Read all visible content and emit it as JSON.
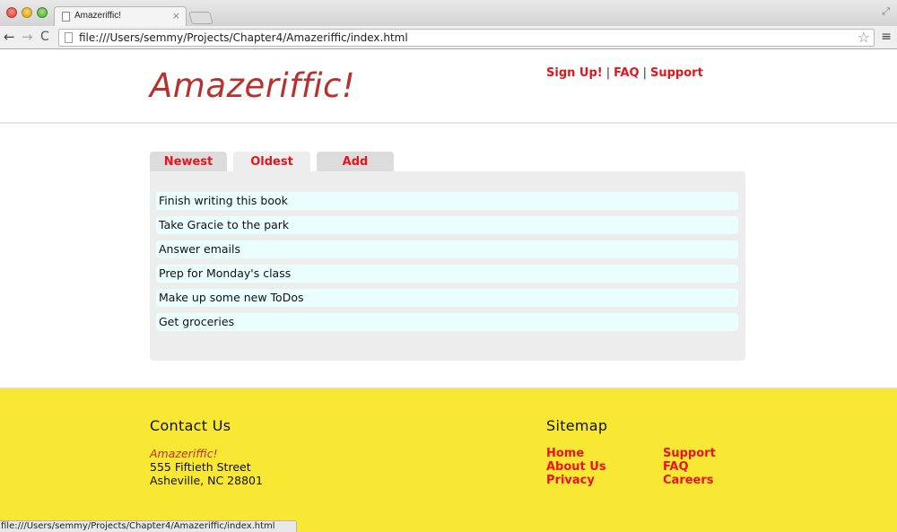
{
  "browser": {
    "tab_title": "Amazeriffic!",
    "tab_close": "×",
    "url": "file:///Users/semmy/Projects/Chapter4/Amazeriffic/index.html",
    "status_url": "file:///Users/semmy/Projects/Chapter4/Amazeriffic/index.html",
    "icons": {
      "back": "←",
      "forward": "→",
      "reload": "C",
      "star": "☆",
      "menu": "≡",
      "fullscreen": "⤢"
    }
  },
  "header": {
    "logo": "Amazeriffic!",
    "nav": [
      {
        "label": "Sign Up!"
      },
      {
        "label": "FAQ"
      },
      {
        "label": "Support"
      }
    ],
    "separator": "|"
  },
  "tabs": [
    {
      "label": "Newest",
      "active": false
    },
    {
      "label": "Oldest",
      "active": true
    },
    {
      "label": "Add",
      "active": false
    }
  ],
  "todos": [
    "Finish writing this book",
    "Take Gracie to the park",
    "Answer emails",
    "Prep for Monday's class",
    "Make up some new ToDos",
    "Get groceries"
  ],
  "footer": {
    "contact": {
      "heading": "Contact Us",
      "brand": "Amazeriffic!",
      "street": "555 Fiftieth Street",
      "city": "Asheville, NC 28801"
    },
    "sitemap": {
      "heading": "Sitemap",
      "col1": [
        "Home",
        "About Us",
        "Privacy"
      ],
      "col2": [
        "Support",
        "FAQ",
        "Careers"
      ]
    }
  },
  "colors": {
    "brand": "#b8312e",
    "link": "#e8141c",
    "footer_bg": "#f9e833",
    "todo_bg": "#ebfefe",
    "panel_bg": "#ededed"
  }
}
